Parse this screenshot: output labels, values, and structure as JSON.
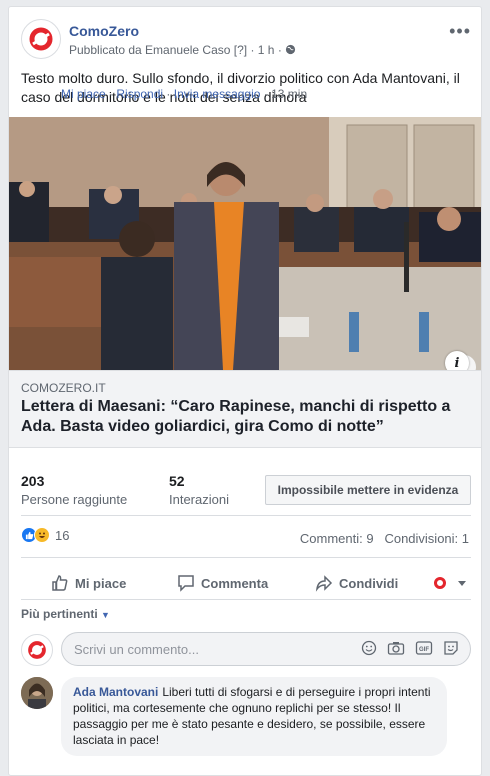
{
  "post": {
    "page_name": "ComoZero",
    "meta_prefix": "Pubblicato da Emanuele Caso",
    "meta_help": "[?]",
    "meta_time": "1 h",
    "more_icon": "more-dots-icon",
    "text": "Testo molto duro. Sullo sfondo, il divorzio politico con Ada Mantovani, il caso del dormitorio e le notti dei senza dimora"
  },
  "link": {
    "domain": "COMOZERO.IT",
    "title": "Lettera di Maesani: “Caro Rapinese, manchi di rispetto a Ada. Basta video goliardici, gira Como di notte”",
    "info_icon": "i"
  },
  "insights": {
    "reach_value": "203",
    "reach_label": "Persone raggiunte",
    "engagement_value": "52",
    "engagement_label": "Interazioni",
    "boost_label": "Impossibile mettere in evidenza"
  },
  "reactions": {
    "count": "16",
    "comments": "Commenti: 9",
    "shares": "Condivisioni: 1"
  },
  "actions": {
    "like": "Mi piace",
    "comment": "Commenta",
    "share": "Condividi"
  },
  "comments_section": {
    "sort_label": "Più pertinenti",
    "input_placeholder": "Scrivi un commento...",
    "first_comment": {
      "author": "Ada Mantovani",
      "text": "Liberi tutti di sfogarsi e di perseguire i propri intenti politici, ma cortesemente che ognuno replichi per se stesso! Il passaggio per me è stato pesante e desidero, se possibile, essere lasciata in pace!",
      "like": "Mi piace",
      "reply": "Rispondi",
      "message": "Invia messaggio",
      "time": "13 min"
    }
  },
  "colors": {
    "brand_red": "#e4262d",
    "link_blue": "#385898",
    "text_gray": "#606770"
  }
}
